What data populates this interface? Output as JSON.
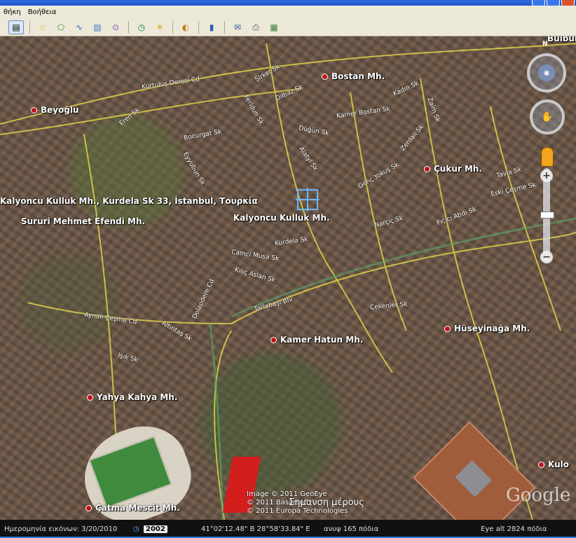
{
  "menu": [
    "θήκη",
    "Βοήθεια"
  ],
  "toolbar": {
    "icons": [
      "sidebar-icon",
      "placemark-icon",
      "polygon-icon",
      "path-icon",
      "image-overlay-icon",
      "tour-icon",
      "historical-imagery-icon",
      "sunlight-icon",
      "planets-icon",
      "ruler-icon",
      "email-icon",
      "print-icon",
      "view-in-maps-icon"
    ]
  },
  "places": [
    {
      "name": "Bostan Mh.",
      "dot": true
    },
    {
      "name": "Beyoğlu",
      "dot": true
    },
    {
      "name": "Çukur Mh.",
      "dot": true
    },
    {
      "name": "Kalyoncu Kulluk Mh., Kurdela Sk 33, İstanbul, Τουρκία",
      "dot": false
    },
    {
      "name": "Sururi Mehmet Efendi Mh.",
      "dot": false
    },
    {
      "name": "Kalyoncu Kulluk Mh.",
      "dot": false
    },
    {
      "name": "Hüseyinağa Mh.",
      "dot": true
    },
    {
      "name": "Kamer Hatun Mh.",
      "dot": true
    },
    {
      "name": "Yahya Kahya Mh.",
      "dot": true
    },
    {
      "name": "Çatma Mescit Mh.",
      "dot": true
    },
    {
      "name": "Bulbul Mh",
      "dot": false
    },
    {
      "name": "Kulo",
      "dot": true
    }
  ],
  "streets": [
    "Kurtuluş Deresi Cd",
    "Şirket Sk",
    "Dilbaz Sk",
    "Feridun Sk",
    "Düğün Sk",
    "Eren Sk",
    "Bocurgat Sk",
    "Eyyubun Sk",
    "Kamer Bostan Sk",
    "Zerdali Sk",
    "Genç Yokuş Sk",
    "Kurdela Sk",
    "Camci Musa Sk",
    "Kılıç Aslan Sk",
    "Tarlabaşı Blv",
    "Çekenler Sk",
    "Aynalı Çeşme Cd",
    "Altıntaş Sk",
    "Işık Sk",
    "Tavla Sk",
    "Eski Çeşme Sk",
    "Narçiç Sk",
    "Fıçıcı Abdi Sk",
    "Kadın Sk",
    "Zaim Sk",
    "Alatyl Sk",
    "Dolapdere Cd"
  ],
  "attribution": [
    "Image © 2011 GeoEye",
    "© 2011 Basarsoft",
    "© 2011 Europa Technologies"
  ],
  "caption": "Σημανση μέρους",
  "google": "Google",
  "status": {
    "date_label": "Ημερομηνία εικόνων: 3/20/2010",
    "year": "2002",
    "coords": "41°02'12.48\" Β   28°58'33.84\" Ε",
    "elev": "ανυψ  165 πόδια",
    "eye_alt": "Eye alt   2824 πόδια"
  },
  "nav": {
    "north": "N",
    "zoom_plus": "+",
    "zoom_minus": "−"
  }
}
